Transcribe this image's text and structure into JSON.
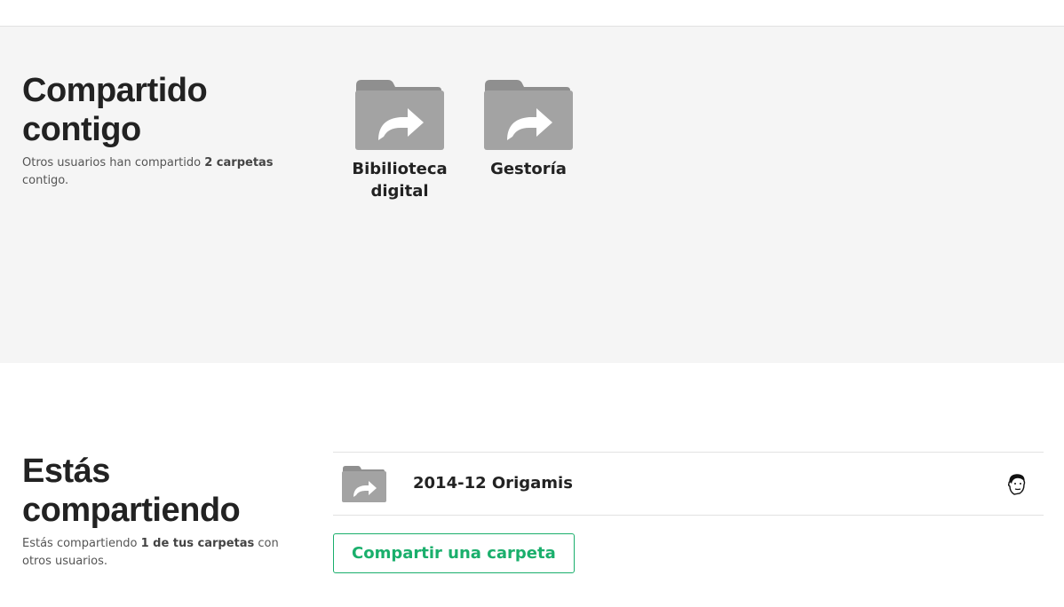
{
  "shared_with_you": {
    "title": "Compartido contigo",
    "description": {
      "before": "Otros usuarios han compartido ",
      "count": "2 carpetas",
      "after": " contigo."
    },
    "folders": [
      {
        "name": "Bibilioteca digital",
        "icon": "shared-folder-icon"
      },
      {
        "name": "Gestoría",
        "icon": "shared-folder-icon"
      }
    ]
  },
  "you_are_sharing": {
    "title": "Estás compartiendo",
    "description": {
      "before": "Estás compartiendo ",
      "count": "1 de tus carpetas",
      "after": " con otros usuarios."
    },
    "rows": [
      {
        "name": "2014-12 Origamis",
        "icon": "shared-folder-icon",
        "member_icon": "user-avatar-icon"
      }
    ],
    "share_button_label": "Compartir una carpeta"
  },
  "colors": {
    "folder": "#a3a3a3",
    "folder_tab": "#8f8f8f",
    "accent": "#1aaf6c",
    "section_bg": "#f5f5f5"
  }
}
